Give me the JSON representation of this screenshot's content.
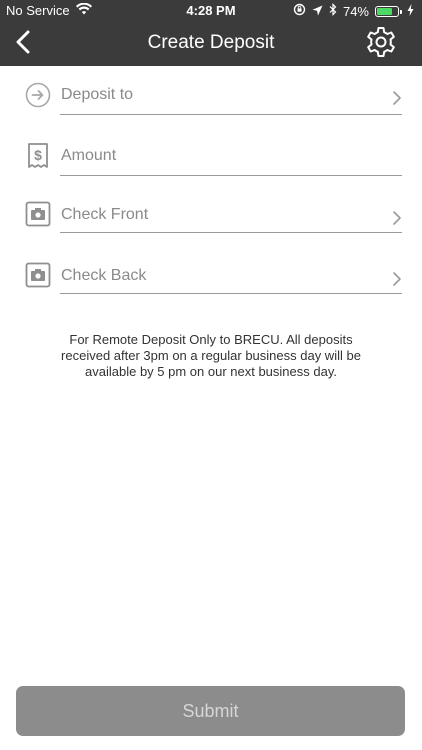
{
  "status_bar": {
    "carrier": "No Service",
    "time": "4:28 PM",
    "battery_percent": "74%",
    "battery_level": 0.74,
    "icons": [
      "wifi-icon",
      "orientation-lock-icon",
      "location-arrow-icon",
      "bluetooth-icon",
      "battery-icon",
      "charging-bolt-icon"
    ],
    "battery_color": "#4cd964"
  },
  "nav": {
    "title": "Create Deposit",
    "back_icon": "chevron-left-icon",
    "settings_icon": "gear-icon"
  },
  "form": {
    "deposit_to": {
      "label": "Deposit to",
      "icon": "arrow-circle-icon",
      "has_chevron": true
    },
    "amount": {
      "label": "Amount",
      "icon": "receipt-dollar-icon",
      "has_chevron": false
    },
    "check_front": {
      "label": "Check Front",
      "icon": "camera-icon",
      "has_chevron": true
    },
    "check_back": {
      "label": "Check Back",
      "icon": "camera-icon",
      "has_chevron": true
    }
  },
  "disclaimer": "For Remote Deposit Only to BRECU. All deposits received after 3pm on a regular business day will be available by 5 pm on our next business day.",
  "submit": {
    "label": "Submit",
    "background": "#8c8c8c"
  },
  "colors": {
    "header_background": "#3b3b3b",
    "label_gray": "#8a8a8a",
    "divider": "#9a9a9a"
  }
}
